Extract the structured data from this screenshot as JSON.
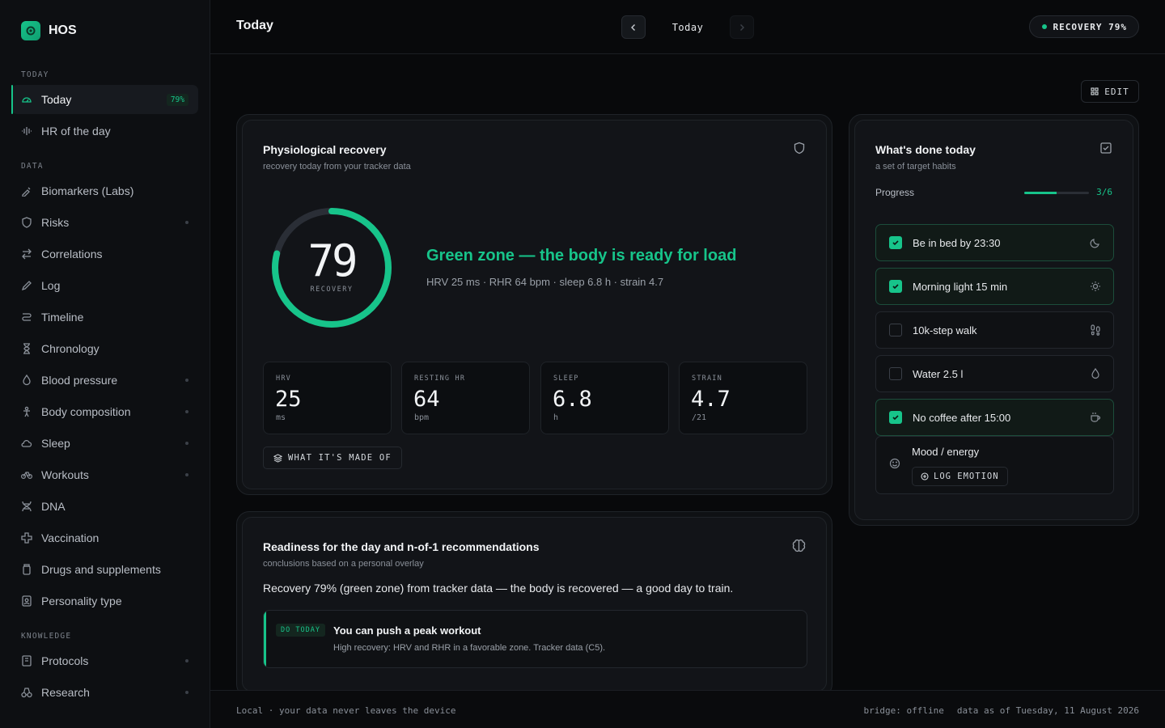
{
  "brand": {
    "name": "HOS"
  },
  "sidebar": {
    "sections": {
      "today": "TODAY",
      "data": "DATA",
      "knowledge": "KNOWLEDGE"
    },
    "items": [
      {
        "label": "Today",
        "badge": "79%"
      },
      {
        "label": "HR of the day"
      },
      {
        "label": "Biomarkers (Labs)"
      },
      {
        "label": "Risks"
      },
      {
        "label": "Correlations"
      },
      {
        "label": "Log"
      },
      {
        "label": "Timeline"
      },
      {
        "label": "Chronology"
      },
      {
        "label": "Blood pressure"
      },
      {
        "label": "Body composition"
      },
      {
        "label": "Sleep"
      },
      {
        "label": "Workouts"
      },
      {
        "label": "DNA"
      },
      {
        "label": "Vaccination"
      },
      {
        "label": "Drugs and supplements"
      },
      {
        "label": "Personality type"
      },
      {
        "label": "Protocols"
      },
      {
        "label": "Research"
      }
    ]
  },
  "header": {
    "title": "Today",
    "date_label": "Today",
    "recovery_pill": "RECOVERY 79%",
    "edit_label": "EDIT"
  },
  "recovery_card": {
    "title": "Physiological recovery",
    "subtitle": "recovery today from your tracker data",
    "score": "79",
    "score_fraction": 0.79,
    "score_label": "RECOVERY",
    "zone_title": "Green zone — the body is ready for load",
    "zone_sub": "HRV 25 ms · RHR 64 bpm · sleep 6.8 h · strain 4.7",
    "metrics": [
      {
        "label": "HRV",
        "value": "25",
        "unit": "ms"
      },
      {
        "label": "RESTING HR",
        "value": "64",
        "unit": "bpm"
      },
      {
        "label": "SLEEP",
        "value": "6.8",
        "unit": "h"
      },
      {
        "label": "STRAIN",
        "value": "4.7",
        "unit": "/21"
      }
    ],
    "made_of_label": "WHAT IT'S MADE OF"
  },
  "habits_card": {
    "title": "What's done today",
    "subtitle": "a set of target habits",
    "progress_label": "Progress",
    "progress_value": "3/6",
    "progress_fraction": 0.5,
    "habits": [
      {
        "label": "Be in bed by 23:30",
        "done": true,
        "icon": "moon-icon"
      },
      {
        "label": "Morning light 15 min",
        "done": true,
        "icon": "sun-icon"
      },
      {
        "label": "10k-step walk",
        "done": false,
        "icon": "footprints-icon"
      },
      {
        "label": "Water 2.5 l",
        "done": false,
        "icon": "droplet-icon"
      },
      {
        "label": "No coffee after 15:00",
        "done": true,
        "icon": "coffee-icon"
      }
    ],
    "mood_label": "Mood / energy",
    "mood_button": "LOG EMOTION"
  },
  "readiness_card": {
    "title": "Readiness for the day and n-of-1 recommendations",
    "subtitle": "conclusions based on a personal overlay",
    "text": "Recovery 79% (green zone) from tracker data — the body is recovered — a good day to train.",
    "rec_tag": "DO TODAY",
    "rec_title": "You can push a peak workout",
    "rec_desc": "High recovery: HRV and RHR in a favorable zone. Tracker data (C5)."
  },
  "footer": {
    "left": "Local · your data never leaves the device",
    "bridge": "bridge: offline",
    "data_as_of": "data as of Tuesday, 11 August 2026"
  },
  "colors": {
    "accent": "#17c48a",
    "background": "#08090b",
    "card": "#121418"
  }
}
